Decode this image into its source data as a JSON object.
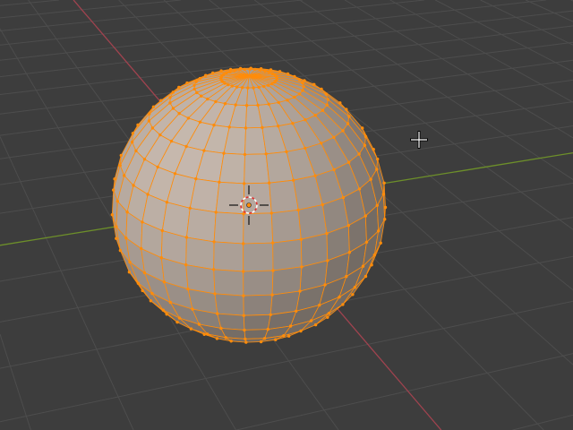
{
  "app": "3D viewport",
  "mode": "edit-mesh",
  "object": {
    "type": "uv-sphere",
    "segments": 32,
    "rings": 16
  },
  "colors": {
    "background": "#3d3d3d",
    "grid": "#4d4d4d",
    "x_axis": "#a0434f",
    "y_axis": "#6d8f2a",
    "mesh_face": "#b9aca2",
    "selection": "#ff8c0a"
  },
  "icons": {
    "cursor3d": "3d-cursor-icon",
    "mouse": "crosshair-cursor-icon"
  }
}
